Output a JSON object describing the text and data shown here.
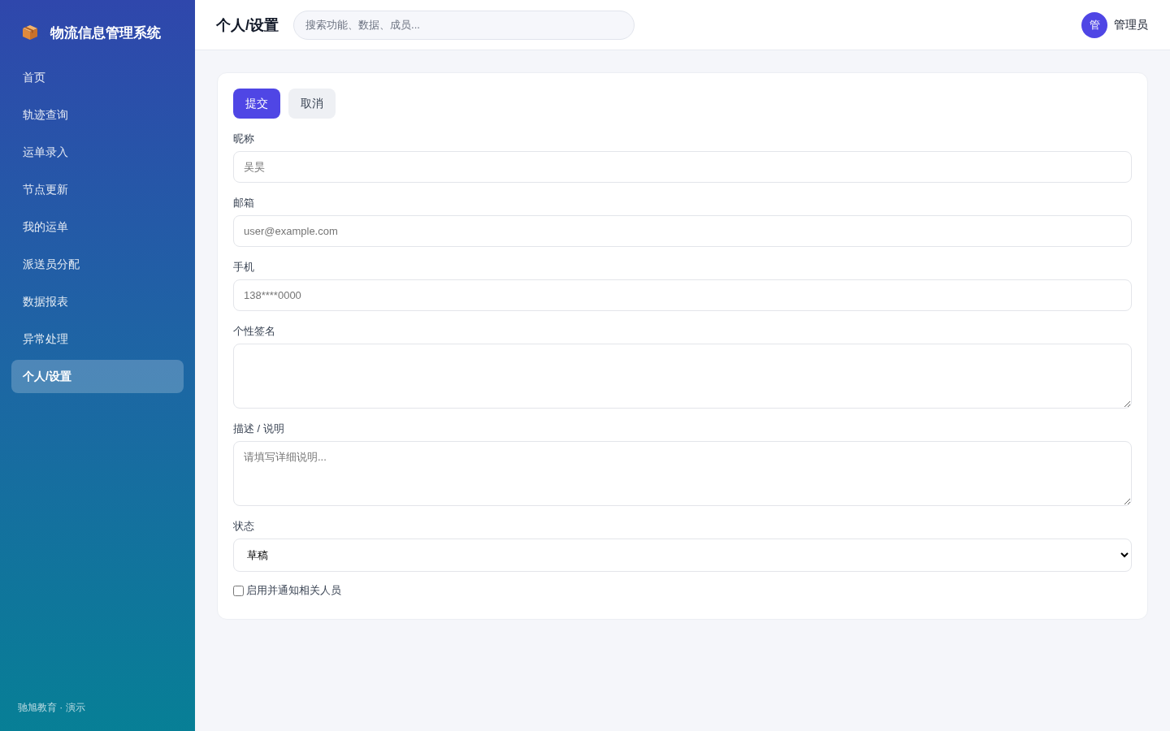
{
  "sidebar": {
    "brand": "物流信息管理系统",
    "items": [
      {
        "label": "首页",
        "selected": false
      },
      {
        "label": "轨迹查询",
        "selected": false
      },
      {
        "label": "运单录入",
        "selected": false
      },
      {
        "label": "节点更新",
        "selected": false
      },
      {
        "label": "我的运单",
        "selected": false
      },
      {
        "label": "派送员分配",
        "selected": false
      },
      {
        "label": "数据报表",
        "selected": false
      },
      {
        "label": "异常处理",
        "selected": false
      },
      {
        "label": "个人/设置",
        "selected": true
      }
    ],
    "footer": "驰旭教育 · 演示"
  },
  "header": {
    "title": "个人/设置",
    "search": {
      "placeholder": "搜索功能、数据、成员..."
    },
    "user": {
      "avatar": "管",
      "name": "管理员"
    }
  },
  "form": {
    "buttons": [
      {
        "label": "提交",
        "kind": "primary"
      },
      {
        "label": "取消",
        "kind": "secondary"
      }
    ],
    "fields": [
      {
        "kind": "input",
        "label": "昵称",
        "placeholder": "吴昊"
      },
      {
        "kind": "input",
        "label": "邮箱",
        "placeholder": "user@example.com"
      },
      {
        "kind": "input",
        "label": "手机",
        "placeholder": "138****0000"
      },
      {
        "kind": "textarea",
        "label": "个性签名"
      },
      {
        "kind": "textarea",
        "label": "描述 / 说明",
        "placeholder": "请填写详细说明..."
      },
      {
        "kind": "select",
        "label": "状态",
        "value": "草稿"
      }
    ],
    "checkbox": {
      "label": "启用并通知相关人员",
      "checked": false
    }
  }
}
